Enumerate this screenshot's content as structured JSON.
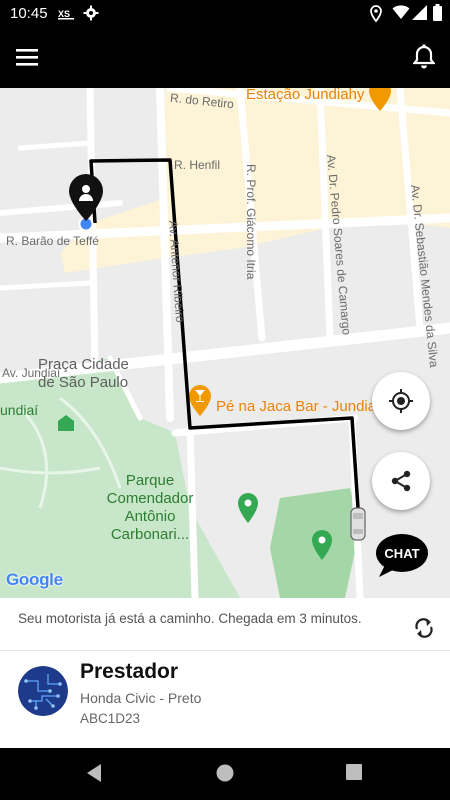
{
  "status_bar": {
    "time": "10:45",
    "left_icons": [
      "xs-notification-icon",
      "gear-icon"
    ],
    "right_icons": [
      "location-icon",
      "wifi-icon",
      "signal-icon",
      "battery-icon"
    ]
  },
  "app_bar": {
    "menu_icon": "hamburger-menu-icon",
    "notification_icon": "bell-icon"
  },
  "map": {
    "labels": {
      "r_do_retiro": "R. do Retiro",
      "estacao_jundiahy": "Estação Jundiahy",
      "r_henfil": "R. Henfil",
      "r_prof_giacomo_itria": "R. Prof. Giácomo Itria",
      "av_pedro_soares": "Av. Dr. Pedro Soares de Camargo",
      "av_sebastiao_mendes": "Av. Dr. Sebastião Mendes da Silva",
      "r_barao_de_teffe": "R. Barão de Teffé",
      "av_antenor_ribeiro": "Av. Antenor Ribeiro",
      "av_jundiai": "Av. Jundiaí",
      "praca_cidade_line1": "Praça Cidade",
      "praca_cidade_line2": "de São Paulo",
      "pe_na_jaca": "Pé na Jaca Bar - Jundiaí",
      "jundiai_partial": "undiaí",
      "parque_line1": "Parque",
      "parque_line2": "Comendador",
      "parque_line3": "Antônio",
      "parque_line4": "Carbonari..."
    },
    "google_logo": "Google",
    "colors": {
      "route": "#000000",
      "user_dot": "#4285f4",
      "park": "#c8e6c9",
      "poi_orange": "#f29900",
      "poi_green": "#34a853",
      "highlight_zone": "#fdf3d6"
    },
    "buttons": {
      "my_location_icon": "crosshair-location-icon",
      "share_icon": "share-icon",
      "chat_label": "CHAT"
    }
  },
  "trip": {
    "status_message": "Seu motorista já está a caminho. Chegada em 3 minutos.",
    "refresh_icon": "refresh-icon"
  },
  "driver": {
    "name": "Prestador",
    "car": "Honda Civic - Preto",
    "plate": "ABC1D23",
    "avatar_icon": "circuit-avatar-icon"
  },
  "nav_bar": {
    "back_icon": "back-triangle-icon",
    "home_icon": "home-circle-icon",
    "recents_icon": "recents-square-icon"
  }
}
